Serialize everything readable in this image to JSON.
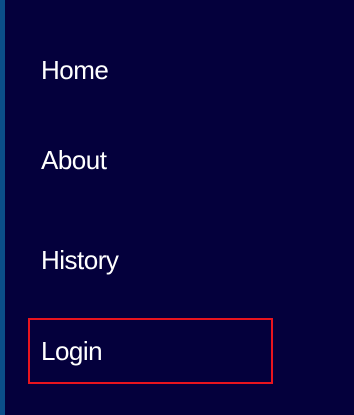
{
  "nav": {
    "items": [
      {
        "label": "Home",
        "focused": false
      },
      {
        "label": "About",
        "focused": false
      },
      {
        "label": "History",
        "focused": false
      },
      {
        "label": "Login",
        "focused": true
      }
    ]
  },
  "colors": {
    "background": "#04003c",
    "text": "#ffffff",
    "focus_outline": "#e8141e",
    "edge": "#0b4f8a"
  }
}
